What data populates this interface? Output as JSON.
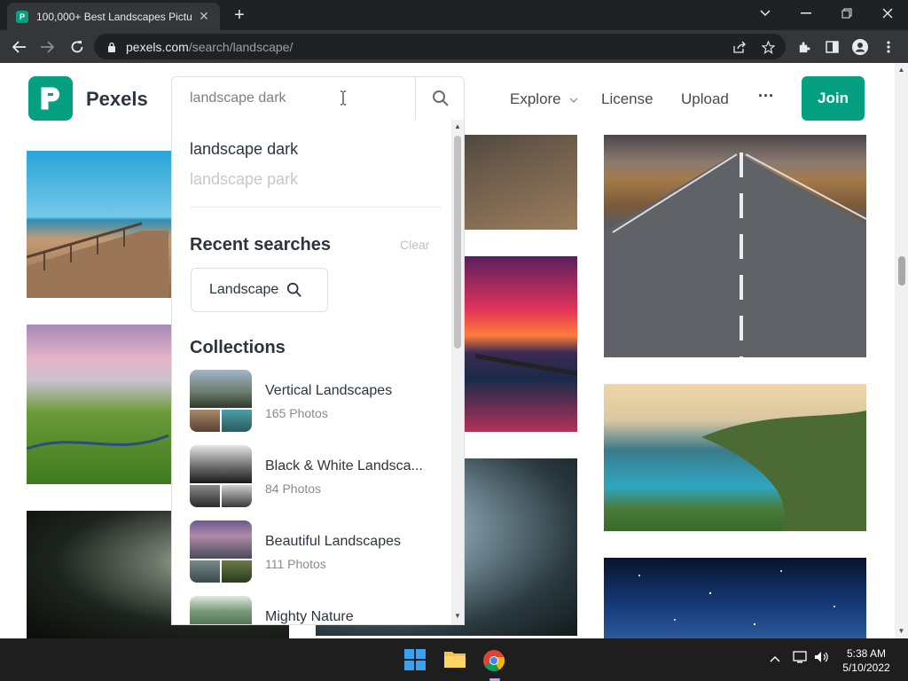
{
  "browser": {
    "tab_title": "100,000+ Best Landscapes Pictur",
    "tab_favicon": "P",
    "new_tab": "+",
    "url_host": "pexels.com",
    "url_path": "/search/landscape/"
  },
  "header": {
    "brand": "Pexels",
    "nav": {
      "explore": "Explore",
      "license": "License",
      "upload": "Upload",
      "more": "···",
      "join": "Join"
    }
  },
  "search": {
    "value": "landscape dark",
    "suggestions": [
      "landscape dark",
      "landscape park"
    ],
    "recent_heading": "Recent searches",
    "clear_label": "Clear",
    "recent_items": [
      "Landscape"
    ],
    "collections_heading": "Collections",
    "collections": [
      {
        "name": "Vertical Landscapes",
        "count": "165 Photos"
      },
      {
        "name": "Black & White Landsca...",
        "count": "84 Photos"
      },
      {
        "name": "Beautiful Landscapes",
        "count": "111 Photos"
      },
      {
        "name": "Mighty Nature",
        "count": ""
      }
    ]
  },
  "taskbar": {
    "time": "5:38 AM",
    "date": "5/10/2022"
  },
  "colors": {
    "brand_green": "#05a081",
    "chrome_dark": "#202124",
    "chrome_toolbar": "#35363a"
  }
}
